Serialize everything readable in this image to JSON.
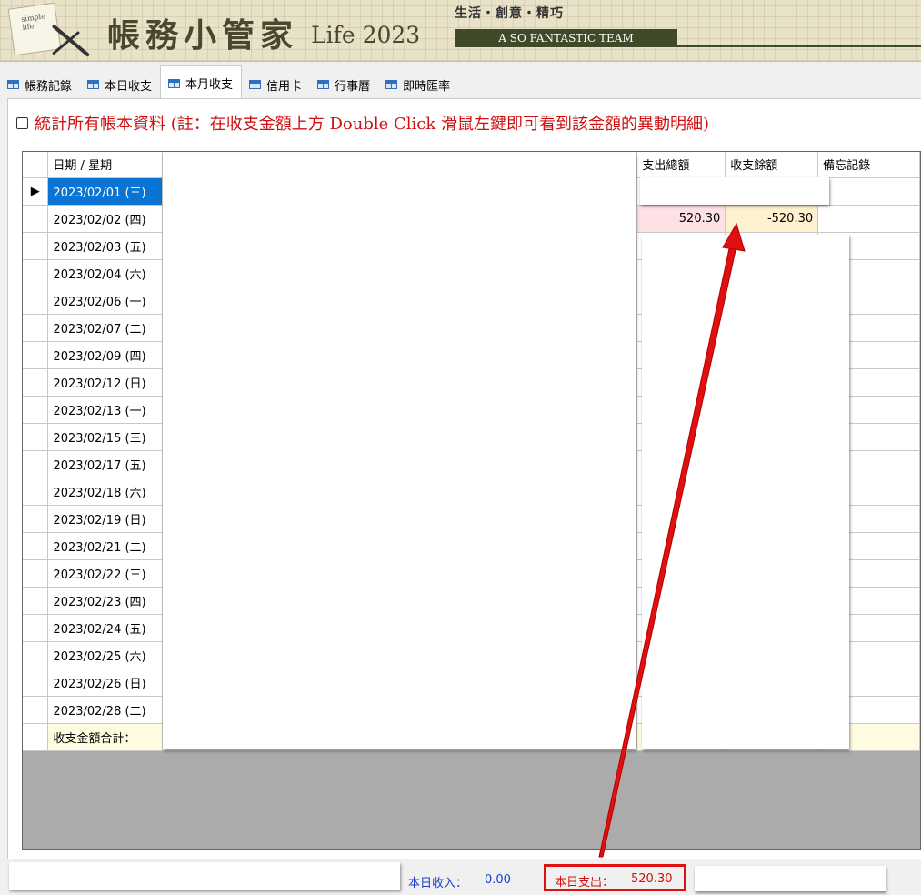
{
  "banner": {
    "logo_text": "simple life",
    "title": "帳務小管家",
    "subtitle": "Life 2023",
    "slogan": "生活・創意・精巧",
    "team": "A SO FANTASTIC TEAM"
  },
  "tabs": [
    {
      "label": "帳務記錄"
    },
    {
      "label": "本日收支"
    },
    {
      "label": "本月收支",
      "active": true
    },
    {
      "label": "信用卡"
    },
    {
      "label": "行事曆"
    },
    {
      "label": "即時匯率"
    }
  ],
  "note": {
    "checkbox_checked": false,
    "text": "統計所有帳本資料 (註：在收支金額上方 Double Click 滑鼠左鍵即可看到該金額的異動明細)"
  },
  "grid": {
    "columns": {
      "date": "日期 / 星期",
      "out": "支出總額",
      "balance": "收支餘額",
      "memo": "備忘記錄"
    },
    "current_row_marker": "▶",
    "rows": [
      {
        "date": "2023/02/01 (三)",
        "out": "",
        "balance": ""
      },
      {
        "date": "2023/02/02 (四)",
        "out": "520.30",
        "balance": "-520.30"
      },
      {
        "date": "2023/02/03 (五)",
        "out": "",
        "balance": ""
      },
      {
        "date": "2023/02/04 (六)",
        "out": "",
        "balance": ""
      },
      {
        "date": "2023/02/06 (一)",
        "out": "",
        "balance": ""
      },
      {
        "date": "2023/02/07 (二)",
        "out": "",
        "balance": ""
      },
      {
        "date": "2023/02/09 (四)",
        "out": "",
        "balance": ""
      },
      {
        "date": "2023/02/12 (日)",
        "out": "",
        "balance": ""
      },
      {
        "date": "2023/02/13 (一)",
        "out": "",
        "balance": ""
      },
      {
        "date": "2023/02/15 (三)",
        "out": "",
        "balance": ""
      },
      {
        "date": "2023/02/17 (五)",
        "out": "",
        "balance": ""
      },
      {
        "date": "2023/02/18 (六)",
        "out": "",
        "balance": ""
      },
      {
        "date": "2023/02/19 (日)",
        "out": "",
        "balance": ""
      },
      {
        "date": "2023/02/21 (二)",
        "out": "",
        "balance": ""
      },
      {
        "date": "2023/02/22 (三)",
        "out": "",
        "balance": ""
      },
      {
        "date": "2023/02/23 (四)",
        "out": "",
        "balance": ""
      },
      {
        "date": "2023/02/24 (五)",
        "out": "",
        "balance": ""
      },
      {
        "date": "2023/02/25 (六)",
        "out": "",
        "balance": ""
      },
      {
        "date": "2023/02/26 (日)",
        "out": "",
        "balance": ""
      },
      {
        "date": "2023/02/28 (二)",
        "out": "",
        "balance": ""
      }
    ],
    "total_label": "收支金額合計："
  },
  "status": {
    "income_label": "本日收入：",
    "income_value": "0.00",
    "out_label": "本日支出：",
    "out_value": "520.30"
  },
  "colors": {
    "selected": "#0a74d4",
    "highlight_border": "#e01010",
    "income_text": "#1a3fd0",
    "out_text": "#d01010"
  }
}
